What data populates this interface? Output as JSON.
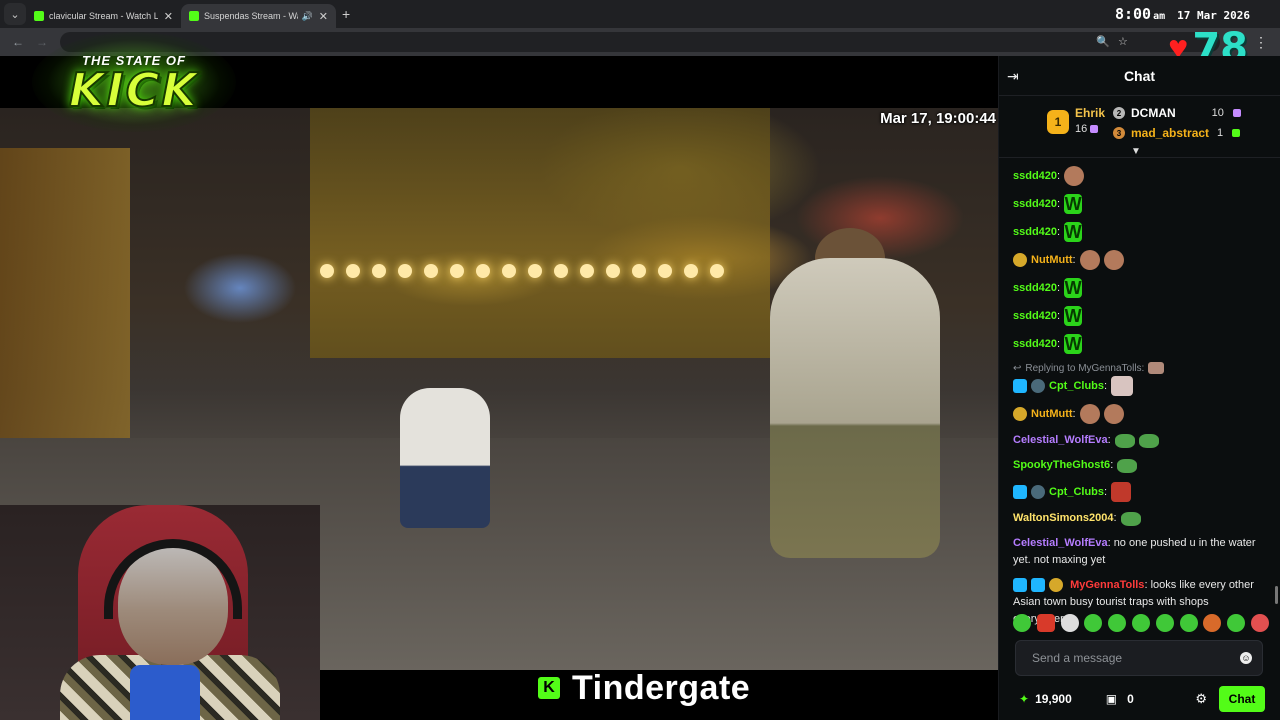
{
  "browser": {
    "tabs": [
      {
        "title": "clavicular Stream - Watch Live o",
        "active": false
      },
      {
        "title": "Suspendas Stream - Watch",
        "active": true
      }
    ],
    "new_tab": "+",
    "clock": {
      "time": "8:00",
      "ampm": "am",
      "date": "17 Mar 2026"
    }
  },
  "overlay": {
    "logo_top": "THE STATE OF",
    "logo_main": "KICK",
    "sub_count": "78",
    "caption": "Tindergate",
    "video_timestamp": "Mar 17, 19:00:44"
  },
  "chat": {
    "title": "Chat",
    "leaderboard": {
      "first": {
        "rank": "1",
        "name": "Ehrik",
        "count": "16"
      },
      "others": [
        {
          "rank": "2",
          "name": "DCMAN",
          "count": "10",
          "name_color": "#ffffff"
        },
        {
          "rank": "3",
          "name": "mad_abstract",
          "count": "1",
          "name_color": "#f5b21a"
        }
      ]
    },
    "messages": [
      {
        "user": "ssdd420",
        "color": "#53fc18",
        "emotes": [
          "face"
        ]
      },
      {
        "user": "ssdd420",
        "color": "#53fc18",
        "emotes": [
          "w"
        ]
      },
      {
        "user": "ssdd420",
        "color": "#53fc18",
        "emotes": [
          "w"
        ]
      },
      {
        "user": "NutMutt",
        "color": "#f5b21a",
        "emotes": [
          "face",
          "face"
        ]
      },
      {
        "user": "ssdd420",
        "color": "#53fc18",
        "emotes": [
          "w"
        ]
      },
      {
        "user": "ssdd420",
        "color": "#53fc18",
        "emotes": [
          "w"
        ]
      },
      {
        "user": "ssdd420",
        "color": "#53fc18",
        "emotes": [
          "w"
        ]
      },
      {
        "user": "Cpt_Clubs",
        "color": "#53fc18",
        "reply": "Replying to MyGennaTolls:",
        "emotes": [
          "cat"
        ]
      },
      {
        "user": "NutMutt",
        "color": "#f5b21a",
        "emotes": [
          "face",
          "face"
        ]
      },
      {
        "user": "Celestial_WolfEva",
        "color": "#b57dff",
        "emotes": [
          "pepe",
          "pepe"
        ]
      },
      {
        "user": "SpookyTheGhost6",
        "color": "#53fc18",
        "emotes": [
          "pepe"
        ]
      },
      {
        "user": "Cpt_Clubs",
        "color": "#53fc18",
        "emotes": [
          "face"
        ]
      },
      {
        "user": "WaltonSimons2004",
        "color": "#ffe36b",
        "emotes": [
          "pepe"
        ]
      },
      {
        "user": "Celestial_WolfEva",
        "color": "#b57dff",
        "text": "no one pushed u in the water yet. not maxing yet"
      },
      {
        "user": "MyGennaTolls",
        "color": "#ff3b3b",
        "text": "looks like every other Asian town busy tourist traps with shops everywhere"
      }
    ],
    "input_placeholder": "Send a message",
    "points": "19,900",
    "store_count": "0",
    "send_label": "Chat"
  }
}
